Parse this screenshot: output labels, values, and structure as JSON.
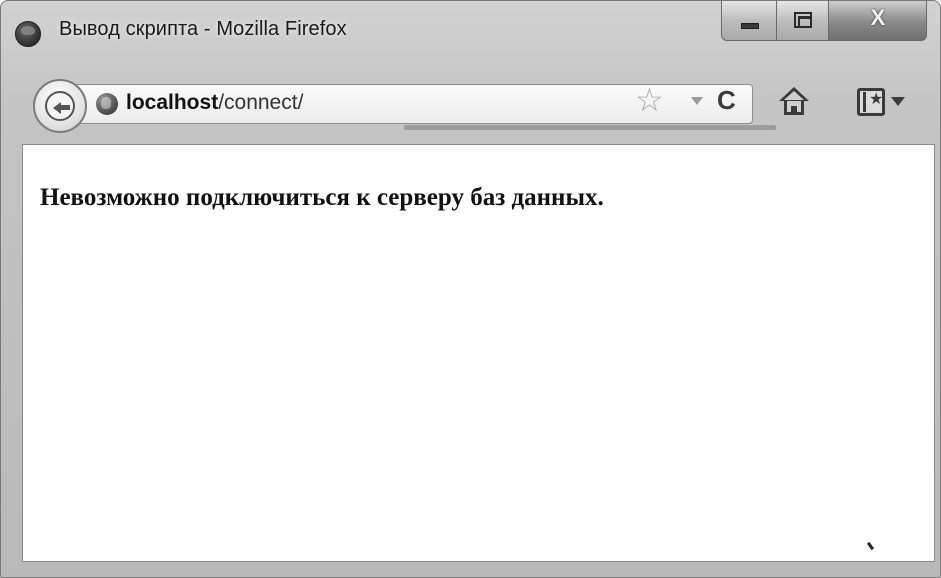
{
  "window": {
    "title": "Вывод скрипта - Mozilla Firefox",
    "controls": {
      "minimize_icon": "minimize-icon",
      "maximize_icon": "maximize-icon",
      "close_label": "X"
    }
  },
  "navbar": {
    "url_host": "localhost",
    "url_path": "/connect/",
    "icons": [
      "back-arrow-icon",
      "globe-icon",
      "star-icon",
      "dropdown-icon",
      "reload-icon",
      "home-icon",
      "bookmarks-icon"
    ],
    "star_glyph": "☆",
    "reload_glyph": "C",
    "bookmark_star_glyph": "★"
  },
  "page": {
    "message": "Невозможно подключиться к серверу баз данных."
  },
  "colors": {
    "chrome": "#c4c4c4",
    "content_bg": "#ffffff",
    "text": "#111111"
  }
}
